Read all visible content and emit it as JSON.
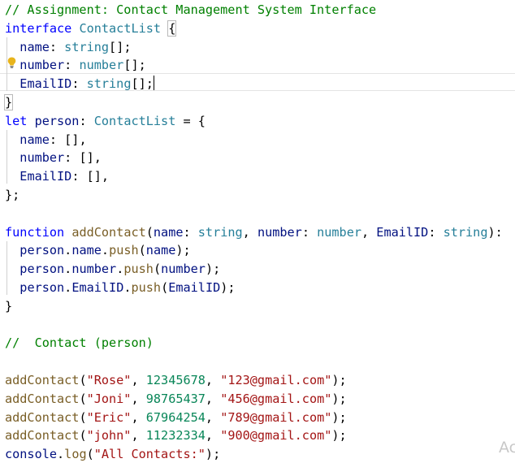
{
  "editor": {
    "lines": [
      [
        {
          "t": "// Assignment: Contact Management System Interface",
          "c": "comment"
        }
      ],
      [
        {
          "t": "interface",
          "c": "keyword"
        },
        {
          "t": " ",
          "c": "plain"
        },
        {
          "t": "ContactList",
          "c": "type"
        },
        {
          "t": " ",
          "c": "plain"
        },
        {
          "t": "{",
          "c": "plain",
          "match": true
        }
      ],
      [
        {
          "t": "  ",
          "c": "plain"
        },
        {
          "t": "name",
          "c": "var"
        },
        {
          "t": ": ",
          "c": "plain"
        },
        {
          "t": "string",
          "c": "type"
        },
        {
          "t": "[];",
          "c": "plain"
        }
      ],
      [
        {
          "t": "  ",
          "c": "plain"
        },
        {
          "t": "number",
          "c": "var"
        },
        {
          "t": ": ",
          "c": "plain"
        },
        {
          "t": "number",
          "c": "type"
        },
        {
          "t": "[];",
          "c": "plain"
        }
      ],
      [
        {
          "t": "  ",
          "c": "plain"
        },
        {
          "t": "EmailID",
          "c": "var"
        },
        {
          "t": ": ",
          "c": "plain"
        },
        {
          "t": "string",
          "c": "type"
        },
        {
          "t": "[];",
          "c": "plain"
        },
        {
          "caret": true
        }
      ],
      [
        {
          "t": "}",
          "c": "plain",
          "match": true
        }
      ],
      [
        {
          "t": "let",
          "c": "keyword"
        },
        {
          "t": " ",
          "c": "plain"
        },
        {
          "t": "person",
          "c": "var"
        },
        {
          "t": ": ",
          "c": "plain"
        },
        {
          "t": "ContactList",
          "c": "type"
        },
        {
          "t": " = {",
          "c": "plain"
        }
      ],
      [
        {
          "t": "  ",
          "c": "plain"
        },
        {
          "t": "name",
          "c": "var"
        },
        {
          "t": ": [],",
          "c": "plain"
        }
      ],
      [
        {
          "t": "  ",
          "c": "plain"
        },
        {
          "t": "number",
          "c": "var"
        },
        {
          "t": ": [],",
          "c": "plain"
        }
      ],
      [
        {
          "t": "  ",
          "c": "plain"
        },
        {
          "t": "EmailID",
          "c": "var"
        },
        {
          "t": ": [],",
          "c": "plain"
        }
      ],
      [
        {
          "t": "};",
          "c": "plain"
        }
      ],
      [],
      [
        {
          "t": "function",
          "c": "keyword"
        },
        {
          "t": " ",
          "c": "plain"
        },
        {
          "t": "addContact",
          "c": "func"
        },
        {
          "t": "(",
          "c": "plain"
        },
        {
          "t": "name",
          "c": "var"
        },
        {
          "t": ": ",
          "c": "plain"
        },
        {
          "t": "string",
          "c": "type"
        },
        {
          "t": ", ",
          "c": "plain"
        },
        {
          "t": "number",
          "c": "var"
        },
        {
          "t": ": ",
          "c": "plain"
        },
        {
          "t": "number",
          "c": "type"
        },
        {
          "t": ", ",
          "c": "plain"
        },
        {
          "t": "EmailID",
          "c": "var"
        },
        {
          "t": ": ",
          "c": "plain"
        },
        {
          "t": "string",
          "c": "type"
        },
        {
          "t": "):",
          "c": "plain"
        }
      ],
      [
        {
          "t": "  ",
          "c": "plain"
        },
        {
          "t": "person",
          "c": "var"
        },
        {
          "t": ".",
          "c": "plain"
        },
        {
          "t": "name",
          "c": "var"
        },
        {
          "t": ".",
          "c": "plain"
        },
        {
          "t": "push",
          "c": "func"
        },
        {
          "t": "(",
          "c": "plain"
        },
        {
          "t": "name",
          "c": "var"
        },
        {
          "t": ");",
          "c": "plain"
        }
      ],
      [
        {
          "t": "  ",
          "c": "plain"
        },
        {
          "t": "person",
          "c": "var"
        },
        {
          "t": ".",
          "c": "plain"
        },
        {
          "t": "number",
          "c": "var"
        },
        {
          "t": ".",
          "c": "plain"
        },
        {
          "t": "push",
          "c": "func"
        },
        {
          "t": "(",
          "c": "plain"
        },
        {
          "t": "number",
          "c": "var"
        },
        {
          "t": ");",
          "c": "plain"
        }
      ],
      [
        {
          "t": "  ",
          "c": "plain"
        },
        {
          "t": "person",
          "c": "var"
        },
        {
          "t": ".",
          "c": "plain"
        },
        {
          "t": "EmailID",
          "c": "var"
        },
        {
          "t": ".",
          "c": "plain"
        },
        {
          "t": "push",
          "c": "func"
        },
        {
          "t": "(",
          "c": "plain"
        },
        {
          "t": "EmailID",
          "c": "var"
        },
        {
          "t": ");",
          "c": "plain"
        }
      ],
      [
        {
          "t": "}",
          "c": "plain"
        }
      ],
      [],
      [
        {
          "t": "//  Contact (person)",
          "c": "comment"
        }
      ],
      [],
      [
        {
          "t": "addContact",
          "c": "func"
        },
        {
          "t": "(",
          "c": "plain"
        },
        {
          "t": "\"Rose\"",
          "c": "string"
        },
        {
          "t": ", ",
          "c": "plain"
        },
        {
          "t": "12345678",
          "c": "number"
        },
        {
          "t": ", ",
          "c": "plain"
        },
        {
          "t": "\"123@gmail.com\"",
          "c": "string"
        },
        {
          "t": ");",
          "c": "plain"
        }
      ],
      [
        {
          "t": "addContact",
          "c": "func"
        },
        {
          "t": "(",
          "c": "plain"
        },
        {
          "t": "\"Joni\"",
          "c": "string"
        },
        {
          "t": ", ",
          "c": "plain"
        },
        {
          "t": "98765437",
          "c": "number"
        },
        {
          "t": ", ",
          "c": "plain"
        },
        {
          "t": "\"456@gmail.com\"",
          "c": "string"
        },
        {
          "t": ");",
          "c": "plain"
        }
      ],
      [
        {
          "t": "addContact",
          "c": "func"
        },
        {
          "t": "(",
          "c": "plain"
        },
        {
          "t": "\"Eric\"",
          "c": "string"
        },
        {
          "t": ", ",
          "c": "plain"
        },
        {
          "t": "67964254",
          "c": "number"
        },
        {
          "t": ", ",
          "c": "plain"
        },
        {
          "t": "\"789@gmail.com\"",
          "c": "string"
        },
        {
          "t": ");",
          "c": "plain"
        }
      ],
      [
        {
          "t": "addContact",
          "c": "func"
        },
        {
          "t": "(",
          "c": "plain"
        },
        {
          "t": "\"john\"",
          "c": "string"
        },
        {
          "t": ", ",
          "c": "plain"
        },
        {
          "t": "11232334",
          "c": "number"
        },
        {
          "t": ", ",
          "c": "plain"
        },
        {
          "t": "\"900@gmail.com\"",
          "c": "string"
        },
        {
          "t": ");",
          "c": "plain"
        }
      ],
      [
        {
          "t": "console",
          "c": "var"
        },
        {
          "t": ".",
          "c": "plain"
        },
        {
          "t": "log",
          "c": "func"
        },
        {
          "t": "(",
          "c": "plain"
        },
        {
          "t": "\"All Contacts:\"",
          "c": "string"
        },
        {
          "t": ");",
          "c": "plain"
        }
      ]
    ],
    "lightbulb_icon": "lightbulb-icon",
    "watermark": "Ac"
  }
}
